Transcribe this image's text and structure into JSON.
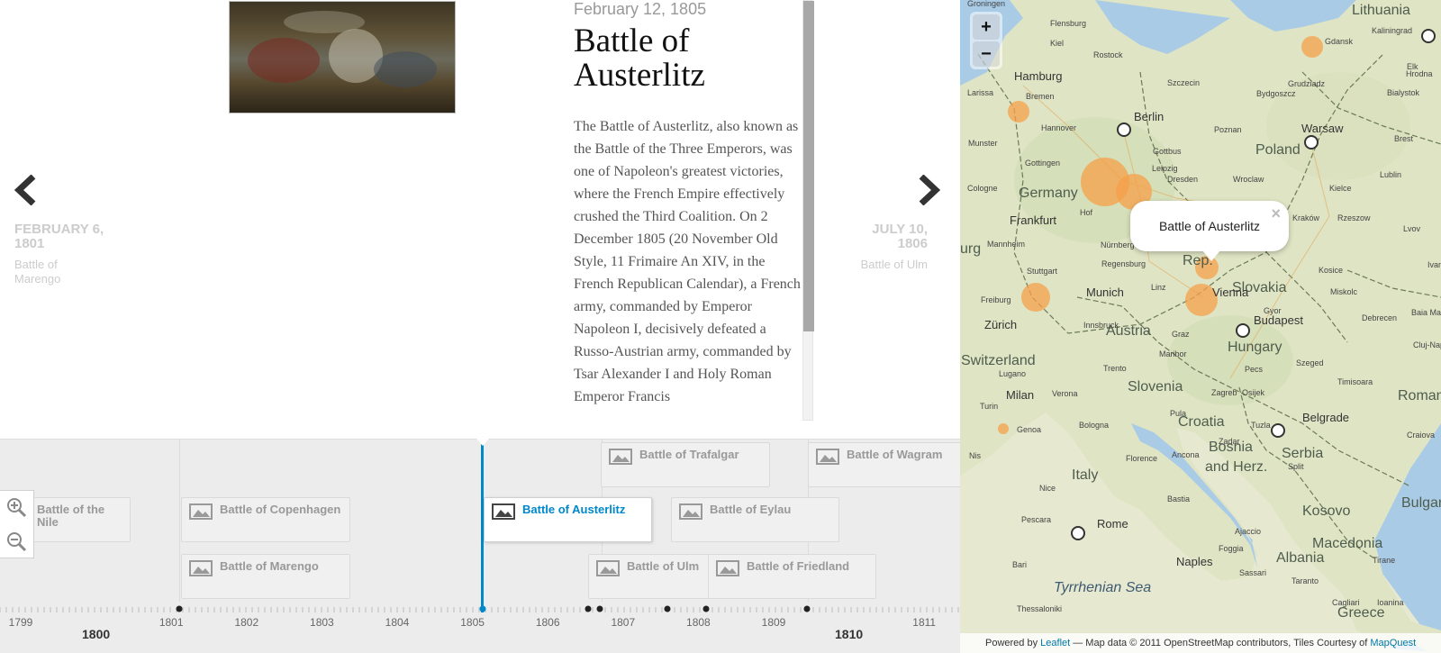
{
  "slide": {
    "date": "February 12, 1805",
    "title": "Battle of Austerlitz",
    "body": "The Battle of Austerlitz, also known as the Battle of the Three Emperors, was one of Napoleon's greatest victories, where the French Empire effectively crushed the Third Coalition. On 2 December 1805 (20 November Old Style, 11 Frimaire An XIV, in the French Republican Calendar), a French army, commanded by Emperor Napoleon I, decisively defeated a Russo-Austrian army, commanded by Tsar Alexander I and Holy Roman Emperor Francis"
  },
  "nav": {
    "prev_date": "FEBRUARY 6, 1801",
    "prev_title": "Battle of Marengo",
    "next_date": "JULY 10, 1806",
    "next_title": "Battle of Ulm"
  },
  "timeline": {
    "markers": {
      "nile": "Battle of the Nile",
      "copenhagen": "Battle of Copenhagen",
      "marengo": "Battle of Marengo",
      "austerlitz": "Battle of Austerlitz",
      "trafalgar": "Battle of Trafalgar",
      "eylau": "Battle of Eylau",
      "ulm": "Battle of Ulm",
      "friedland": "Battle of Friedland",
      "wagram": "Battle of Wagram"
    },
    "years": [
      "1799",
      "1800",
      "1801",
      "1802",
      "1803",
      "1804",
      "1805",
      "1806",
      "1807",
      "1808",
      "1809",
      "1810",
      "1811"
    ],
    "major_years": [
      "1800",
      "1810"
    ]
  },
  "map": {
    "zoom_in": "+",
    "zoom_out": "−",
    "popup": "Battle of Austerlitz",
    "popup_close": "×",
    "attribution": {
      "powered": "Powered by",
      "leaflet": "Leaflet",
      "middle": "— Map data © 2011 OpenStreetMap contributors, Tiles Courtesy of",
      "mapquest": "MapQuest"
    },
    "countries": {
      "lithuania": "Lithuania",
      "germany": "Germany",
      "poland": "Poland",
      "slovakia": "Slovakia",
      "austria": "Austria",
      "hungary": "Hungary",
      "switzerland": "Switzerland",
      "slovenia": "Slovenia",
      "croatia": "Croatia",
      "bosnia": "Bosnia",
      "herz": "and Herz.",
      "serbia": "Serbia",
      "italy": "Italy",
      "kosovo": "Kosovo",
      "macedonia": "Macedonia",
      "albania": "Albania",
      "greece": "Greece",
      "romania": "Romani",
      "bulgaria": "Bulgar",
      "rep": "Rep.",
      "burg": "urg"
    },
    "cities": {
      "hamburg": "Hamburg",
      "berlin": "Berlin",
      "warsaw": "Warsaw",
      "frankfurt": "Frankfurt",
      "munich": "Munich",
      "vienna": "Vienna",
      "budapest": "Budapest",
      "zurich": "Zürich",
      "milan": "Milan",
      "belgrade": "Belgrade",
      "rome": "Rome",
      "naples": "Naples"
    },
    "towns": [
      "Flensburg",
      "Kiel",
      "Rostock",
      "Gdansk",
      "Kaliningrad",
      "Elk",
      "Hrodna",
      "Bremen",
      "Szczecin",
      "Bydgoszcz",
      "Grudziadz",
      "Bialystok",
      "Hannover",
      "Poznan",
      "Munster",
      "Gottbus",
      "Brest",
      "Gottingen",
      "Leipzig",
      "Dresden",
      "Wroclaw",
      "Lublin",
      "Kielce",
      "Cologne",
      "Kraków",
      "Rzeszow",
      "Hof",
      "Lvov",
      "Mannheim",
      "Nürnberg",
      "Brno",
      "Kosice",
      "Ivano",
      "Stuttgart",
      "Regensburg",
      "Linz",
      "Freiburg",
      "Innsbruck",
      "Graz",
      "Gyor",
      "Miskolc",
      "Debrecen",
      "Baia Mare",
      "Cluj-Napoca",
      "Lugano",
      "Trento",
      "Maribor",
      "Pecs",
      "Szeged",
      "Timisoara",
      "Turin",
      "Verona",
      "Zagreb",
      "Osijek",
      "Genoa",
      "Bologna",
      "Pula",
      "Tuzla",
      "Craiova",
      "Florence",
      "Ancona",
      "Zadar",
      "Split",
      "Nis",
      "Nice",
      "Bastia",
      "Pescara",
      "Ajaccio",
      "Foggia",
      "Bari",
      "Sassari",
      "Taranto",
      "Tirane",
      "Thessaloniki",
      "Cagliari",
      "Ioanina",
      "Larissa",
      "Groningen"
    ],
    "sea": "Tyrrhenian Sea"
  }
}
